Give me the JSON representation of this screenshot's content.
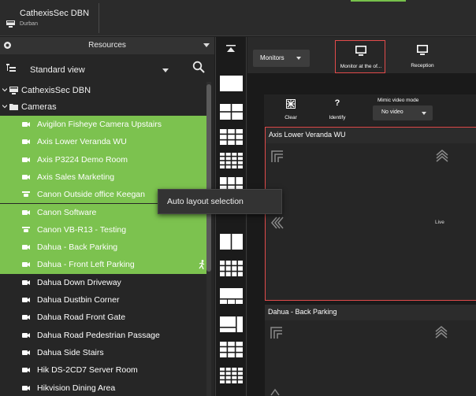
{
  "site": {
    "name": "CathexisSec DBN",
    "subtitle": "Durban"
  },
  "resources": {
    "title": "Resources",
    "view_label": "Standard view",
    "tree": {
      "root_label": "CathexisSec DBN",
      "cameras_label": "Cameras"
    },
    "cameras": [
      {
        "label": "Avigilon Fisheye Camera Upstairs",
        "selected": true,
        "icon": "camera-icon"
      },
      {
        "label": "Axis Lower Veranda WU",
        "selected": true,
        "icon": "camera-icon"
      },
      {
        "label": "Axis P3224 Demo Room",
        "selected": true,
        "icon": "camera-icon"
      },
      {
        "label": "Axis Sales Marketing",
        "selected": true,
        "icon": "camera-icon"
      },
      {
        "label": "Canon Outside office Keegan",
        "selected": true,
        "icon": "ptz-camera-icon"
      },
      {
        "label": "Canon Software",
        "selected": true,
        "icon": "camera-icon"
      },
      {
        "label": "Canon VB-R13 - Testing",
        "selected": true,
        "icon": "ptz-camera-icon"
      },
      {
        "label": "Dahua - Back Parking",
        "selected": true,
        "icon": "camera-icon"
      },
      {
        "label": "Dahua - Front Left Parking",
        "selected": true,
        "icon": "camera-icon",
        "motion": true
      },
      {
        "label": "Dahua Down Driveway",
        "selected": false,
        "icon": "camera-icon"
      },
      {
        "label": "Dahua Dustbin Corner",
        "selected": false,
        "icon": "camera-icon"
      },
      {
        "label": "Dahua Road Front Gate",
        "selected": false,
        "icon": "camera-icon"
      },
      {
        "label": "Dahua Road Pedestrian Passage",
        "selected": false,
        "icon": "camera-icon"
      },
      {
        "label": "Dahua Side Stairs",
        "selected": false,
        "icon": "camera-icon"
      },
      {
        "label": "Hik DS-2CD7 Server Room",
        "selected": false,
        "icon": "camera-icon"
      },
      {
        "label": "Hikvision Dining Area",
        "selected": false,
        "icon": "camera-icon"
      }
    ]
  },
  "popup": {
    "label": "Auto layout selection"
  },
  "monitors": {
    "dropdown_label": "Monitors",
    "tiles": [
      {
        "label": "Monitor at the of...",
        "selected": true
      },
      {
        "label": "Reception",
        "selected": false
      }
    ]
  },
  "controls": {
    "clear_label": "Clear",
    "identify_label": "Identify",
    "identify_glyph": "?",
    "mimic_label": "Mimic video mode",
    "mimic_value": "No video"
  },
  "video_tiles": [
    {
      "title": "Axis Lower Veranda WU",
      "status": "Live",
      "selected": true
    },
    {
      "title": "Dahua - Back Parking",
      "status": "",
      "selected": false
    }
  ],
  "colors": {
    "selection_green": "#7cc24f",
    "selection_red": "#e24b4b",
    "accent_top": "#77c14b"
  }
}
